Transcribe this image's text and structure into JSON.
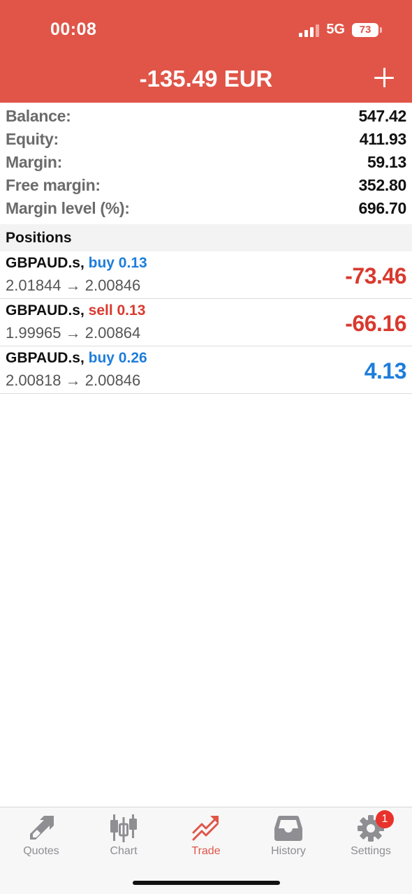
{
  "status_bar": {
    "time": "00:08",
    "network": "5G",
    "battery": "73"
  },
  "header": {
    "title": "-135.49 EUR",
    "add_icon": "plus-icon",
    "background_color": "#e05548"
  },
  "summary": [
    {
      "label": "Balance:",
      "value": "547.42"
    },
    {
      "label": "Equity:",
      "value": "411.93"
    },
    {
      "label": "Margin:",
      "value": "59.13"
    },
    {
      "label": "Free margin:",
      "value": "352.80"
    },
    {
      "label": "Margin level (%):",
      "value": "696.70"
    }
  ],
  "positions": {
    "title": "Positions",
    "items": [
      {
        "symbol": "GBPAUD.s,",
        "side": "buy 0.13",
        "prices": "2.01844 → 2.00846",
        "profit": "-73.46"
      },
      {
        "symbol": "GBPAUD.s,",
        "side": "sell 0.13",
        "prices": "1.99965 → 2.00864",
        "profit": "-66.16"
      },
      {
        "symbol": "GBPAUD.s,",
        "side": "buy 0.26",
        "prices": "2.00818 → 2.00846",
        "profit": "4.13"
      }
    ]
  },
  "tabbar": {
    "tabs": [
      {
        "label": "Quotes",
        "icon": "quotes-arrows-icon"
      },
      {
        "label": "Chart",
        "icon": "candlestick-icon"
      },
      {
        "label": "Trade",
        "icon": "trade-trend-icon",
        "active": true
      },
      {
        "label": "History",
        "icon": "inbox-tray-icon"
      },
      {
        "label": "Settings",
        "icon": "gear-icon",
        "badge": "1"
      }
    ]
  },
  "colors": {
    "accent": "#e05548",
    "buy": "#1e7ddb",
    "sell": "#d9392e"
  }
}
